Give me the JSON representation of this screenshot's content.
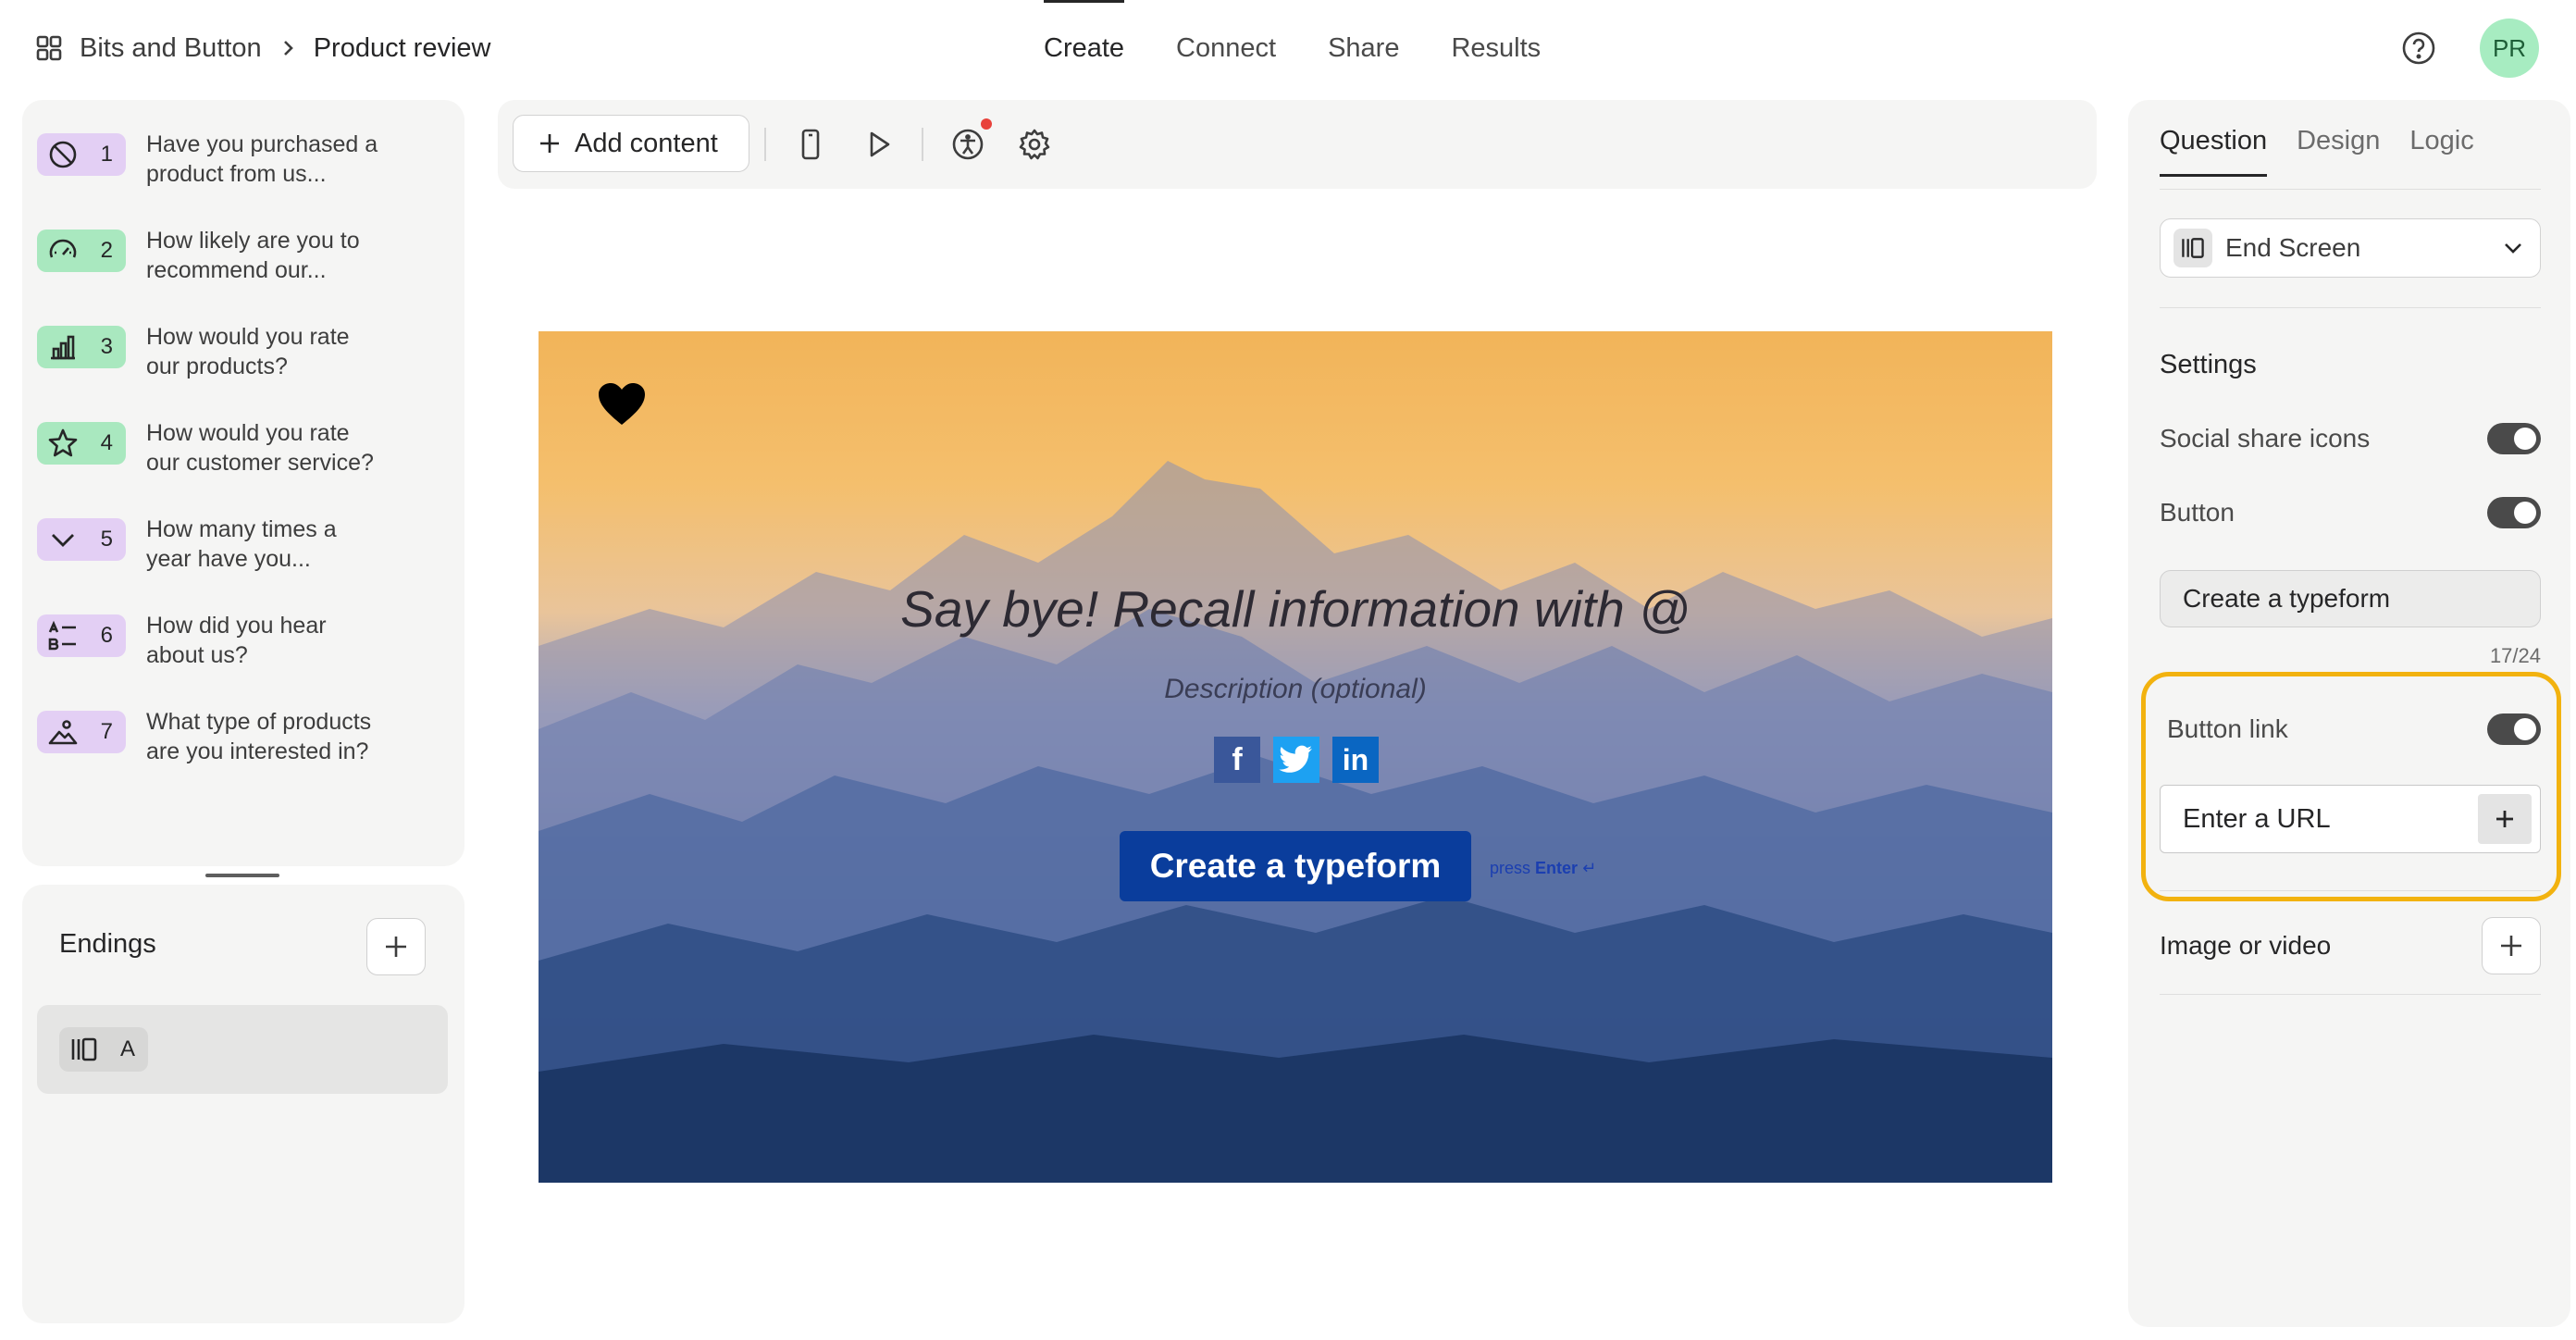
{
  "header": {
    "workspace": "Bits and Button",
    "page": "Product review",
    "tabs": [
      "Create",
      "Connect",
      "Share",
      "Results"
    ],
    "active_tab": "Create",
    "avatar_initials": "PR"
  },
  "questions": [
    {
      "num": "1",
      "line1": "Have you purchased a",
      "line2": "product from us...",
      "icon": "ban-icon",
      "color": "#e3cff4"
    },
    {
      "num": "2",
      "line1": "How likely are you to",
      "line2": "recommend our...",
      "icon": "gauge-icon",
      "color": "#a9e8bf"
    },
    {
      "num": "3",
      "line1": "How would you rate",
      "line2": "our products?",
      "icon": "bar-chart-icon",
      "color": "#a9e8bf"
    },
    {
      "num": "4",
      "line1": "How would you rate",
      "line2": "our customer service?",
      "icon": "star-icon",
      "color": "#a9e8bf"
    },
    {
      "num": "5",
      "line1": "How many times a",
      "line2": "year have you...",
      "icon": "chevron-down-icon",
      "color": "#e3cff4"
    },
    {
      "num": "6",
      "line1": "How did you hear",
      "line2": "about us?",
      "icon": "list-icon",
      "color": "#e3cff4"
    },
    {
      "num": "7",
      "line1": "What type of products",
      "line2": "are you interested in?",
      "icon": "picture-choice-icon",
      "color": "#e3cff4"
    }
  ],
  "endings": {
    "title": "Endings",
    "items": [
      {
        "label": "A",
        "icon": "end-screen-icon"
      }
    ]
  },
  "toolbar": {
    "add_content": "Add content",
    "icons": [
      "mobile-icon",
      "play-icon",
      "accessibility-icon",
      "settings-icon"
    ]
  },
  "preview": {
    "title": "Say bye! Recall information with @",
    "description": "Description (optional)",
    "button": "Create a typeform",
    "hint_prefix": "press ",
    "hint_key": "Enter",
    "hint_glyph": "↵",
    "social": [
      "f",
      "t",
      "in"
    ]
  },
  "right_panel": {
    "tabs": [
      "Question",
      "Design",
      "Logic"
    ],
    "active_tab": "Question",
    "type": "End Screen",
    "settings_title": "Settings",
    "social_share_label": "Social share icons",
    "social_share_on": true,
    "button_label": "Button",
    "button_on": true,
    "button_text_value": "Create a typeform",
    "char_counter": "17/24",
    "button_link_label": "Button link",
    "button_link_on": true,
    "url_placeholder": "Enter a URL",
    "image_video_label": "Image or video",
    "highlight_color": "#f2b20f"
  }
}
